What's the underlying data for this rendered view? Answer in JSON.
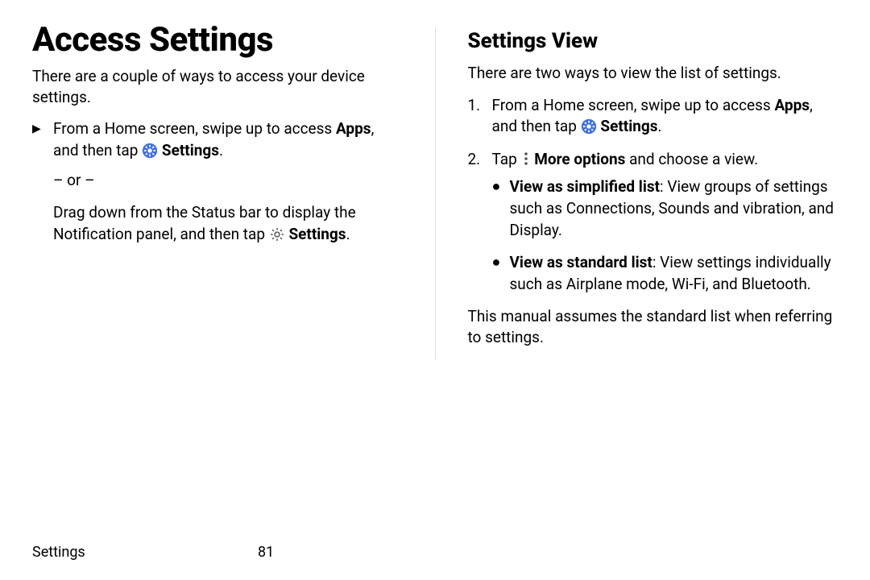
{
  "left": {
    "title": "Access Settings",
    "intro": "There are a couple of ways to access your device settings.",
    "step_prefix": "From a Home screen, swipe up to access ",
    "apps_bold": "Apps",
    "step_mid": ", and then tap ",
    "settings_bold": "Settings",
    "period": ".",
    "or_text": "– or –",
    "alt_prefix": "Drag down from the Status bar to display the Notification panel, and then tap ",
    "alt_settings_bold": "Settings",
    "alt_period": "."
  },
  "right": {
    "title": "Settings View",
    "intro": "There are two ways to view the list of settings.",
    "steps": [
      {
        "num": "1.",
        "prefix": "From a Home screen, swipe up to access ",
        "apps_bold": "Apps",
        "mid": ", and then tap ",
        "settings_bold": "Settings",
        "suffix": "."
      },
      {
        "num": "2.",
        "tap_text": "Tap ",
        "more_bold": "More options",
        "tap_suffix": " and choose a view.",
        "bullets": [
          {
            "title": "View as simplified list",
            "desc": ": View groups of settings such as Connections, Sounds and vibration, and Display."
          },
          {
            "title": "View as standard list",
            "desc": ": View settings individually such as Airplane mode, Wi-Fi, and Bluetooth."
          }
        ]
      }
    ],
    "note": "This manual assumes the standard list when referring to settings."
  },
  "footer": {
    "section": "Settings",
    "page": "81"
  }
}
